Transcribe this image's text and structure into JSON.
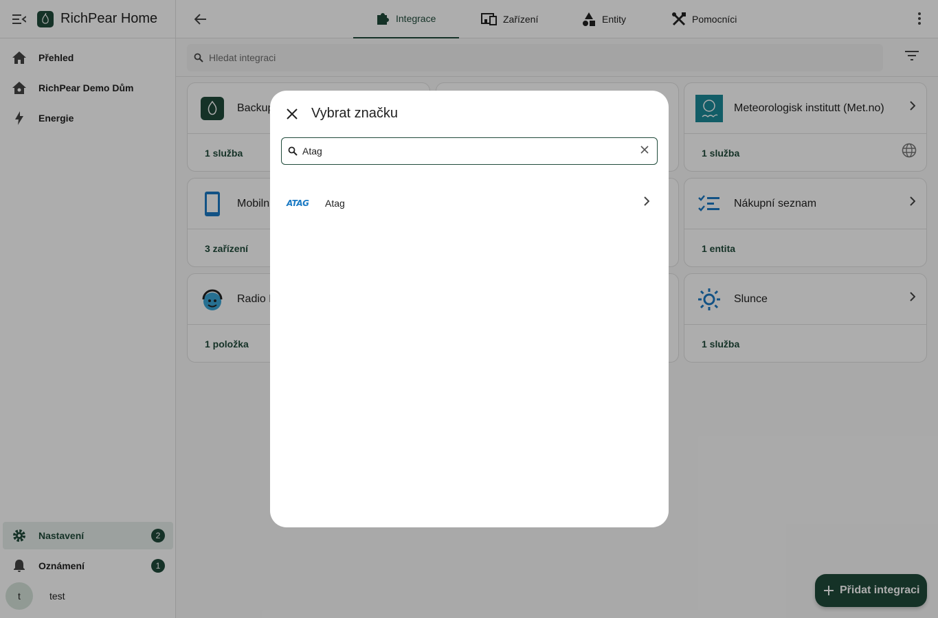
{
  "app": {
    "title": "RichPear Home"
  },
  "sidebar": {
    "items": [
      {
        "label": "Přehled",
        "icon": "home-icon"
      },
      {
        "label": "RichPear Demo Dům",
        "icon": "home-roof-icon"
      },
      {
        "label": "Energie",
        "icon": "lightning-icon"
      }
    ],
    "bottom": [
      {
        "label": "Nastavení",
        "icon": "gear-icon",
        "badge": "2",
        "active": true
      },
      {
        "label": "Oznámení",
        "icon": "bell-icon",
        "badge": "1"
      }
    ],
    "user": {
      "initial": "t",
      "name": "test"
    }
  },
  "topbar": {
    "tabs": [
      {
        "label": "Integrace",
        "icon": "puzzle-icon",
        "active": true
      },
      {
        "label": "Zařízení",
        "icon": "devices-icon"
      },
      {
        "label": "Entity",
        "icon": "shapes-icon"
      },
      {
        "label": "Pomocníci",
        "icon": "tools-icon"
      }
    ]
  },
  "search": {
    "placeholder": "Hledat integraci"
  },
  "cards": [
    {
      "name": "Backup",
      "footer": "1 služba"
    },
    {
      "name": "Meteorologisk institutt (Met.no)",
      "footer": "1 služba"
    },
    {
      "name": "Mobiln",
      "footer": "3 zařízení"
    },
    {
      "name": "Nákupní seznam",
      "footer": "1 entita"
    },
    {
      "name": "Radio B",
      "footer": "1 položka"
    },
    {
      "name": "Slunce",
      "footer": "1 služba"
    }
  ],
  "dialog": {
    "title": "Vybrat značku",
    "search_value": "Atag",
    "results": [
      {
        "logo_text": "ATAG",
        "label": "Atag"
      }
    ]
  },
  "fab": {
    "label": "Přidat integraci"
  },
  "colors": {
    "primary": "#1f4a3a",
    "accent_blue": "#1b7ac4",
    "met_teal": "#1b8a98"
  }
}
